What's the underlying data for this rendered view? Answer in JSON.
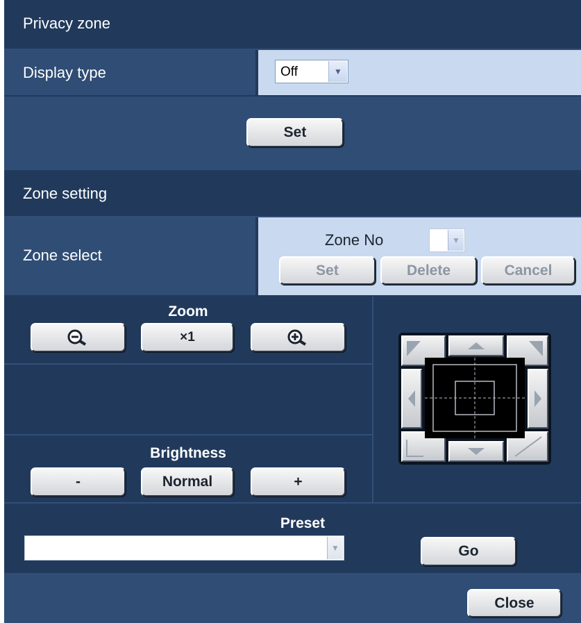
{
  "privacy": {
    "title": "Privacy zone",
    "display_label": "Display type",
    "display_value": "Off",
    "set": "Set"
  },
  "zone": {
    "title": "Zone setting",
    "select_label": "Zone select",
    "zone_no_label": "Zone No",
    "zone_no_value": "",
    "set": "Set",
    "delete": "Delete",
    "cancel": "Cancel"
  },
  "zoom": {
    "title": "Zoom",
    "reset": "×1"
  },
  "brightness": {
    "title": "Brightness",
    "minus": "-",
    "normal": "Normal",
    "plus": "+"
  },
  "preset": {
    "title": "Preset",
    "value": "",
    "go": "Go"
  },
  "close": "Close",
  "colors": {
    "panel": "#213a5c",
    "light_cell": "#c9d9ef",
    "mid_cell": "#2f4d75"
  }
}
